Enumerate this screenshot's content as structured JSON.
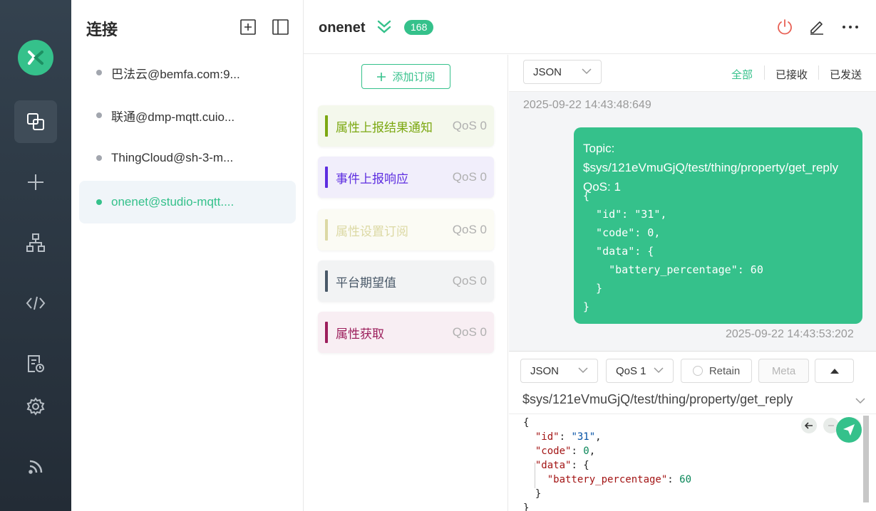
{
  "connections": {
    "title": "连接",
    "items": [
      {
        "name": "巴法云@bemfa.com:9...",
        "status": "offline"
      },
      {
        "name": "联通@dmp-mqtt.cuio...",
        "status": "offline"
      },
      {
        "name": "ThingCloud@sh-3-m...",
        "status": "offline"
      },
      {
        "name": "onenet@studio-mqtt....",
        "status": "online"
      }
    ]
  },
  "topbar": {
    "connection_name": "onenet",
    "message_count": "168"
  },
  "subscriptions": {
    "add_label": "添加订阅",
    "items": [
      {
        "topic": "属性上报结果通知",
        "qos": "QoS 0",
        "color": "#7ca812",
        "bg": "#f4f8ec"
      },
      {
        "topic": "事件上报响应",
        "qos": "QoS 0",
        "color": "#5d2de0",
        "bg": "#f1eefb"
      },
      {
        "topic": "属性设置订阅",
        "qos": "QoS 0",
        "color": "#dcd9a4",
        "bg": "#fbfbf4"
      },
      {
        "topic": "平台期望值",
        "qos": "QoS 0",
        "color": "#495868",
        "bg": "#f2f3f4"
      },
      {
        "topic": "属性获取",
        "qos": "QoS 0",
        "color": "#9c1f5c",
        "bg": "#f8eef3"
      }
    ]
  },
  "messages": {
    "format": "JSON",
    "filters": [
      "全部",
      "已接收",
      "已发送"
    ],
    "active_filter": "全部",
    "prev_timestamp": "2025-09-22 14:43:48:649",
    "sent": {
      "topic_line": "Topic: $sys/121eVmuGjQ/test/thing/property/get_reply    QoS: 1",
      "payload": "{\n  \"id\": \"31\",\n  \"code\": 0,\n  \"data\": {\n    \"battery_percentage\": 60\n  }\n}",
      "timestamp": "2025-09-22 14:43:53:202"
    }
  },
  "publish": {
    "format": "JSON",
    "qos": "QoS 1",
    "retain_label": "Retain",
    "meta_label": "Meta",
    "topic": "$sys/121eVmuGjQ/test/thing/property/get_reply",
    "payload_lines": [
      "{",
      "  \"id\": \"31\",",
      "  \"code\": 0,",
      "  \"data\": {",
      "    \"battery_percentage\": 60",
      "  }",
      "}"
    ]
  },
  "colors": {
    "accent": "#35c18b",
    "rail": "#2c3843"
  }
}
